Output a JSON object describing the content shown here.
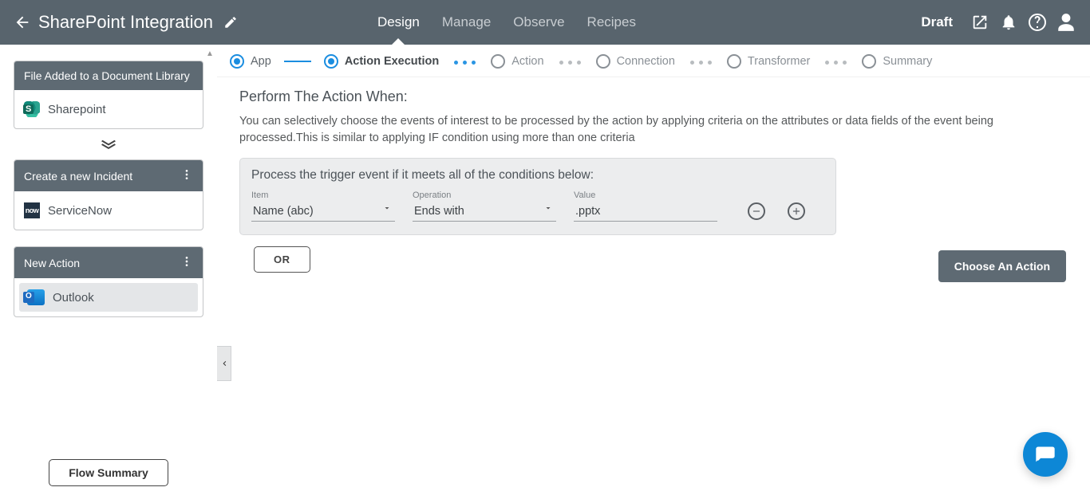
{
  "header": {
    "title": "SharePoint Integration",
    "status": "Draft",
    "tabs": [
      {
        "label": "Design",
        "active": true
      },
      {
        "label": "Manage",
        "active": false
      },
      {
        "label": "Observe",
        "active": false
      },
      {
        "label": "Recipes",
        "active": false
      }
    ]
  },
  "sidebar": {
    "nodes": [
      {
        "type": "trigger",
        "title": "File Added to a Document Library",
        "appName": "Sharepoint",
        "appIcon": "sp",
        "hasMore": false,
        "selected": false
      },
      {
        "type": "action",
        "title": "Create a new Incident",
        "appName": "ServiceNow",
        "appIcon": "snow",
        "hasMore": true,
        "selected": false
      },
      {
        "type": "action",
        "title": "New Action",
        "appName": "Outlook",
        "appIcon": "ol",
        "hasMore": true,
        "selected": true
      }
    ],
    "flowSummaryLabel": "Flow Summary"
  },
  "stepper": {
    "steps": [
      {
        "label": "App",
        "state": "done"
      },
      {
        "label": "Action Execution",
        "state": "active"
      },
      {
        "label": "Action",
        "state": "pending"
      },
      {
        "label": "Connection",
        "state": "pending"
      },
      {
        "label": "Transformer",
        "state": "pending"
      },
      {
        "label": "Summary",
        "state": "pending"
      }
    ]
  },
  "main": {
    "heading": "Perform The Action When:",
    "description": "You can selectively choose the events of interest to be processed by the action by applying criteria on the attributes or data fields of the event being processed.This is similar to applying IF condition using more than one criteria",
    "conditionsTitle": "Process the trigger event if it meets all of the conditions below:",
    "labels": {
      "item": "Item",
      "operation": "Operation",
      "value": "Value"
    },
    "condition": {
      "item": "Name (abc)",
      "operation": "Ends with",
      "value": ".pptx"
    },
    "orLabel": "OR",
    "chooseActionLabel": "Choose An Action"
  }
}
